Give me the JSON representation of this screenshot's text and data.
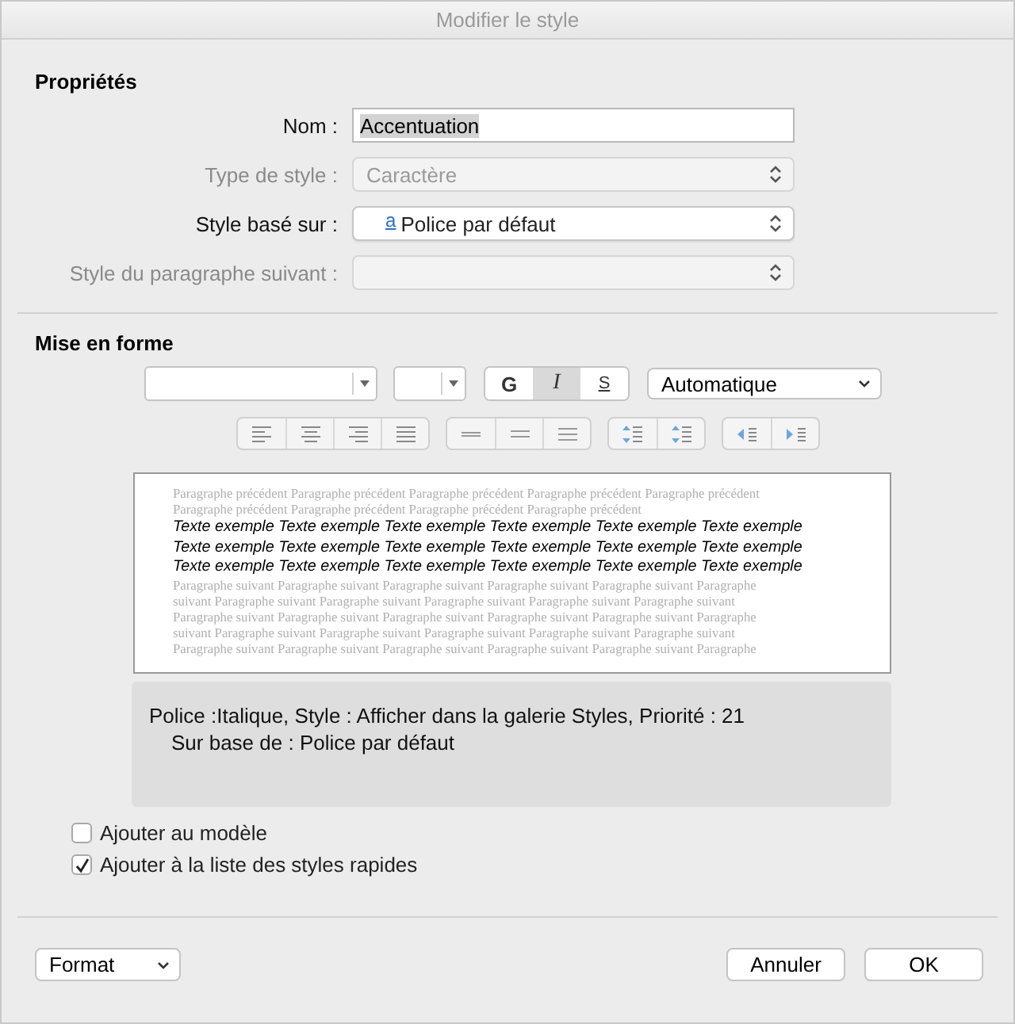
{
  "window": {
    "title": "Modifier le style"
  },
  "properties": {
    "heading": "Propriétés",
    "fields": [
      {
        "label": "Nom :",
        "kind": "text",
        "value": "Accentuation",
        "disabled": false
      },
      {
        "label": "Type de style :",
        "kind": "popup",
        "value": "Caractère",
        "disabled": true
      },
      {
        "label": "Style basé sur :",
        "kind": "popup",
        "icon": "a",
        "value": "Police par défaut",
        "disabled": false
      },
      {
        "label": "Style du paragraphe suivant :",
        "kind": "popup",
        "disabled": true
      }
    ]
  },
  "formatting": {
    "heading": "Mise en forme",
    "style_buttons": [
      {
        "label": "G",
        "kind": "bold",
        "selected": false
      },
      {
        "label": "I",
        "kind": "italic",
        "selected": true
      },
      {
        "label": "S",
        "kind": "underline",
        "selected": false
      }
    ],
    "font_color_menu": "Automatique",
    "paragraph_groups": [
      {
        "buttons": [
          {
            "kind": "align-left"
          },
          {
            "kind": "align-center"
          },
          {
            "kind": "align-right"
          },
          {
            "kind": "justify"
          }
        ]
      },
      {
        "buttons": [
          {
            "kind": "single-spacing"
          },
          {
            "kind": "one-half-spacing"
          },
          {
            "kind": "double-spacing"
          }
        ]
      },
      {
        "buttons": [
          {
            "kind": "space-before"
          },
          {
            "kind": "space-after"
          }
        ]
      },
      {
        "buttons": [
          {
            "kind": "decrease-indent"
          },
          {
            "kind": "increase-indent"
          }
        ]
      }
    ]
  },
  "preview": {
    "preceding": [
      "Paragraphe précédent Paragraphe précédent Paragraphe précédent Paragraphe précédent Paragraphe précédent",
      "Paragraphe précédent Paragraphe précédent Paragraphe précédent Paragraphe précédent"
    ],
    "sample": [
      "Texte exemple Texte exemple Texte exemple Texte exemple Texte exemple Texte exemple",
      "Texte exemple Texte exemple Texte exemple Texte exemple Texte exemple Texte exemple",
      "Texte exemple Texte exemple Texte exemple Texte exemple Texte exemple Texte exemple"
    ],
    "following": [
      "Paragraphe suivant Paragraphe suivant Paragraphe suivant Paragraphe suivant Paragraphe suivant Paragraphe",
      "suivant Paragraphe suivant Paragraphe suivant Paragraphe suivant Paragraphe suivant Paragraphe suivant",
      "Paragraphe suivant Paragraphe suivant Paragraphe suivant Paragraphe suivant Paragraphe suivant Paragraphe",
      "suivant Paragraphe suivant Paragraphe suivant Paragraphe suivant Paragraphe suivant Paragraphe suivant",
      "Paragraphe suivant Paragraphe suivant Paragraphe suivant Paragraphe suivant Paragraphe suivant Paragraphe"
    ]
  },
  "description": {
    "lines": [
      "Police :Italique, Style : Afficher dans la galerie Styles, Priorité : 21",
      "Sur base de : Police par défaut"
    ]
  },
  "checkboxes": [
    {
      "label": "Ajouter au modèle",
      "checked": false
    },
    {
      "label": "Ajouter à la liste des styles rapides",
      "checked": true
    }
  ],
  "footer": {
    "format_menu": "Format",
    "buttons": [
      "Annuler",
      "OK"
    ]
  }
}
